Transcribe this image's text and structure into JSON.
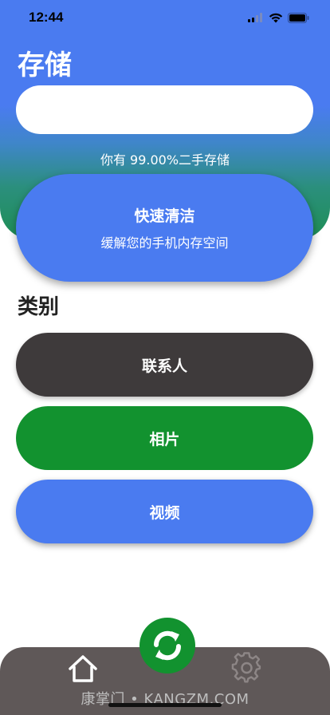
{
  "status_bar": {
    "time": "12:44"
  },
  "header": {
    "title": "存储",
    "storage_text": "你有 99.00%二手存储"
  },
  "quick_clean": {
    "title": "快速清洁",
    "subtitle": "缓解您的手机内存空间"
  },
  "categories": {
    "title": "类别",
    "items": [
      {
        "label": "联系人",
        "color": "#3e3a3b"
      },
      {
        "label": "相片",
        "color": "#12922f"
      },
      {
        "label": "视频",
        "color": "#4a7bf0"
      }
    ]
  },
  "tab_bar": {
    "icons": [
      "home-icon",
      "refresh-icon",
      "gear-icon"
    ],
    "background": "#5f5858",
    "center_color": "#12922f"
  },
  "watermark": "康掌门 • KANGZM.COM",
  "colors": {
    "primary_blue": "#4a7bf0",
    "green": "#12922f",
    "dark": "#3e3a3b"
  }
}
